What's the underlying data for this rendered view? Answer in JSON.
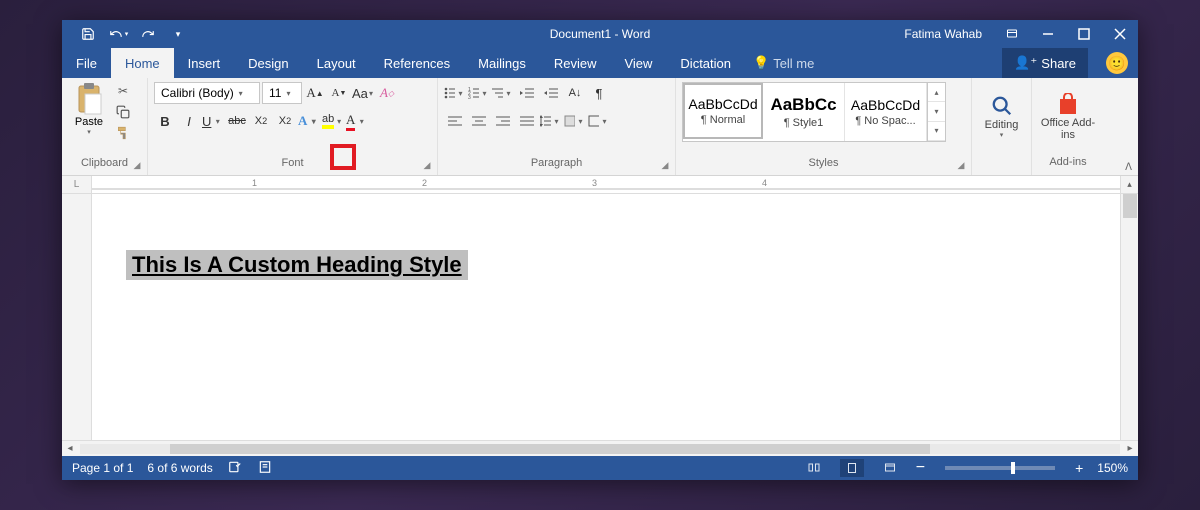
{
  "titlebar": {
    "doc_title": "Document1  -  Word",
    "user_name": "Fatima Wahab"
  },
  "tabs": {
    "file": "File",
    "home": "Home",
    "insert": "Insert",
    "design": "Design",
    "layout": "Layout",
    "references": "References",
    "mailings": "Mailings",
    "review": "Review",
    "view": "View",
    "dictation": "Dictation",
    "tellme": "Tell me",
    "share": "Share"
  },
  "ribbon": {
    "clipboard": {
      "paste": "Paste",
      "label": "Clipboard"
    },
    "font": {
      "name": "Calibri (Body)",
      "size": "11",
      "label": "Font"
    },
    "paragraph": {
      "label": "Paragraph"
    },
    "styles": {
      "label": "Styles",
      "items": [
        {
          "preview": "AaBbCcDd",
          "name": "¶ Normal"
        },
        {
          "preview": "AaBbCc",
          "name": "¶ Style1"
        },
        {
          "preview": "AaBbCcDd",
          "name": "¶ No Spac..."
        }
      ]
    },
    "editing": {
      "label": "Editing"
    },
    "addins": {
      "label": "Add-ins",
      "button": "Office Add-ins"
    }
  },
  "ruler": {
    "n1": "1",
    "n2": "2",
    "n3": "3",
    "n4": "4"
  },
  "document": {
    "heading_text": "This Is A Custom Heading Style"
  },
  "status": {
    "page": "Page 1 of 1",
    "words": "6 of 6 words",
    "zoom": "150%"
  }
}
